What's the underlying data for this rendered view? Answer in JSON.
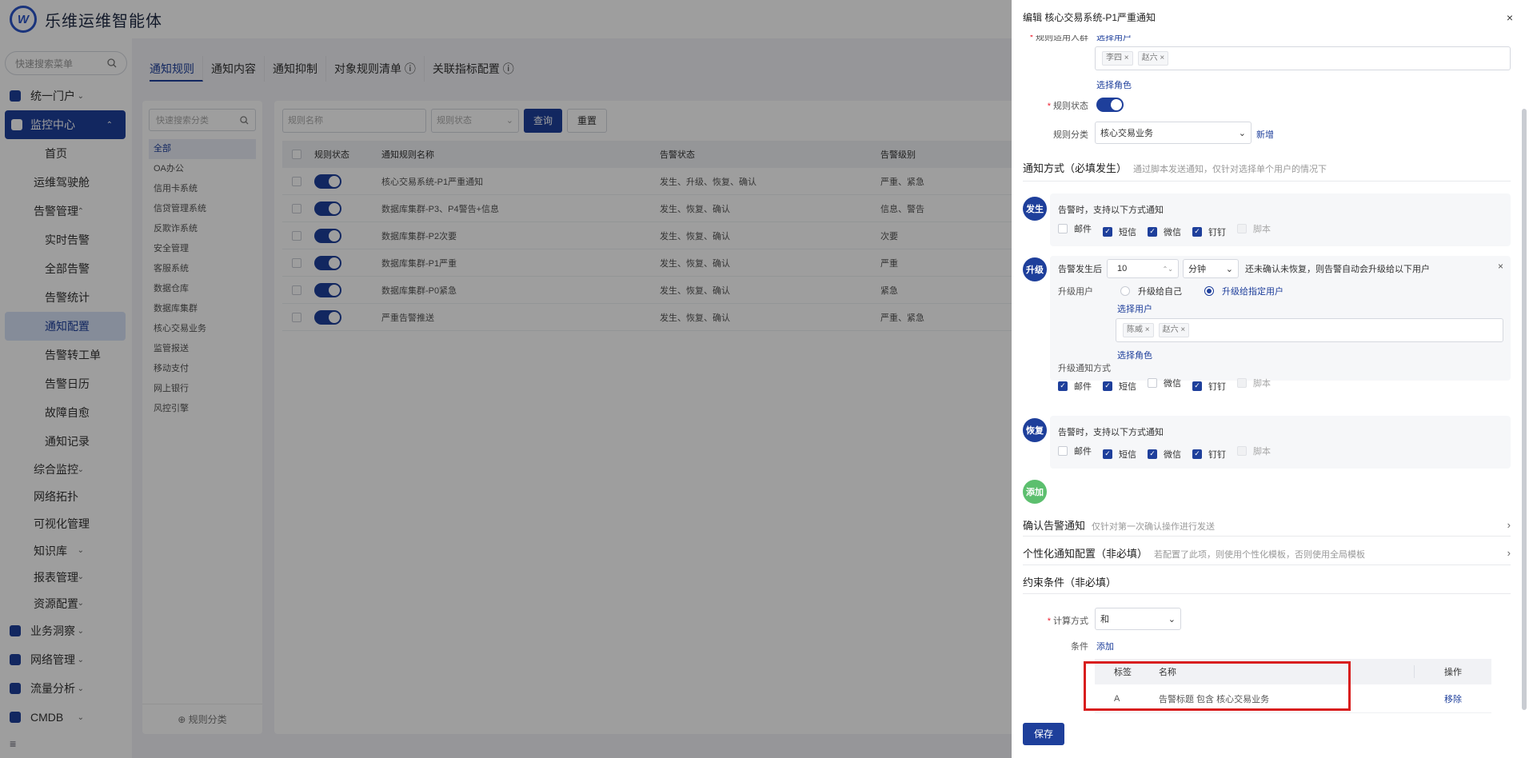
{
  "app": {
    "title": "乐维运维智能体"
  },
  "sidebar": {
    "search_placeholder": "快速搜索菜单",
    "items": [
      {
        "label": "统一门户",
        "arrow": "⌄"
      },
      {
        "label": "监控中心",
        "arrow": "⌃"
      },
      {
        "label": "首页"
      },
      {
        "label": "运维驾驶舱"
      },
      {
        "label": "告警管理",
        "arrow": "⌃"
      },
      {
        "label": "实时告警"
      },
      {
        "label": "全部告警"
      },
      {
        "label": "告警统计"
      },
      {
        "label": "通知配置"
      },
      {
        "label": "告警转工单"
      },
      {
        "label": "告警日历"
      },
      {
        "label": "故障自愈"
      },
      {
        "label": "通知记录"
      },
      {
        "label": "综合监控",
        "arrow": "⌄"
      },
      {
        "label": "网络拓扑"
      },
      {
        "label": "可视化管理",
        "arrow": "⌄"
      },
      {
        "label": "知识库",
        "arrow": "⌄"
      },
      {
        "label": "报表管理",
        "arrow": "⌄"
      },
      {
        "label": "资源配置",
        "arrow": "⌄"
      },
      {
        "label": "业务洞察",
        "arrow": "⌄"
      },
      {
        "label": "网络管理",
        "arrow": "⌄"
      },
      {
        "label": "流量分析",
        "arrow": "⌄"
      },
      {
        "label": "CMDB",
        "arrow": "⌄"
      }
    ],
    "bottom_icon": "≡"
  },
  "tabs": [
    "通知规则",
    "通知内容",
    "通知抑制",
    "对象规则清单 ⓘ",
    "关联指标配置 ⓘ"
  ],
  "categories": {
    "search_placeholder": "快速搜索分类",
    "items": [
      "全部",
      "OA办公",
      "信用卡系统",
      "信贷管理系统",
      "反欺诈系统",
      "安全管理",
      "客服系统",
      "数据仓库",
      "数据库集群",
      "核心交易业务",
      "监管报送",
      "移动支付",
      "网上银行",
      "风控引擎"
    ],
    "footer": "⊕ 规则分类"
  },
  "filters": {
    "name_placeholder": "规则名称",
    "status_placeholder": "规则状态",
    "query": "查询",
    "reset": "重置"
  },
  "rules_table": {
    "headers": [
      "规则状态",
      "通知规则名称",
      "告警状态",
      "告警级别"
    ],
    "rows": [
      {
        "name": "核心交易系统-P1严重通知",
        "states": "发生、升级、恢复、确认",
        "levels": "严重、紧急"
      },
      {
        "name": "数据库集群-P3、P4警告+信息",
        "states": "发生、恢复、确认",
        "levels": "信息、警告"
      },
      {
        "name": "数据库集群-P2次要",
        "states": "发生、恢复、确认",
        "levels": "次要"
      },
      {
        "name": "数据库集群-P1严重",
        "states": "发生、恢复、确认",
        "levels": "严重"
      },
      {
        "name": "数据库集群-P0紧急",
        "states": "发生、恢复、确认",
        "levels": "紧急"
      },
      {
        "name": "严重告警推送",
        "states": "发生、恢复、确认",
        "levels": "严重、紧急"
      }
    ]
  },
  "drawer": {
    "title": "编辑 核心交易系统-P1严重通知",
    "close": "×",
    "audience_label": "规则适用人群",
    "select_user": "选择用户",
    "audience_tags": [
      "李四 ×",
      "赵六 ×"
    ],
    "select_role": "选择角色",
    "status_label": "规则状态",
    "category_label": "规则分类",
    "category_value": "核心交易业务",
    "add_category": "新增",
    "notify_title": "通知方式（必填发生）",
    "notify_sub": "通过脚本发送通知，仅针对选择单个用户的情况下",
    "steps": {
      "occur": {
        "badge": "发生",
        "hint": "告警时，支持以下方式通知",
        "channels": [
          {
            "label": "邮件",
            "checked": false
          },
          {
            "label": "短信",
            "checked": true
          },
          {
            "label": "微信",
            "checked": true
          },
          {
            "label": "钉钉",
            "checked": true
          },
          {
            "label": "脚本",
            "checked": false,
            "disabled": true
          }
        ]
      },
      "escalate": {
        "badge": "升级",
        "after_label": "告警发生后",
        "after_value": "10",
        "unit": "分钟",
        "after_tail": "还未确认未恢复，则告警自动会升级给以下用户",
        "close": "×",
        "user_label": "升级用户",
        "radio_self": "升级给自己",
        "radio_target": "升级给指定用户",
        "select_user": "选择用户",
        "tags": [
          "陈威 ×",
          "赵六 ×"
        ],
        "select_role": "选择角色",
        "channel_label": "升级通知方式",
        "channels": [
          {
            "label": "邮件",
            "checked": true
          },
          {
            "label": "短信",
            "checked": true
          },
          {
            "label": "微信",
            "checked": false
          },
          {
            "label": "钉钉",
            "checked": true
          },
          {
            "label": "脚本",
            "checked": false,
            "disabled": true
          }
        ]
      },
      "recover": {
        "badge": "恢复",
        "hint": "告警时，支持以下方式通知",
        "channels": [
          {
            "label": "邮件",
            "checked": false
          },
          {
            "label": "短信",
            "checked": true
          },
          {
            "label": "微信",
            "checked": true
          },
          {
            "label": "钉钉",
            "checked": true
          },
          {
            "label": "脚本",
            "checked": false,
            "disabled": true
          }
        ]
      },
      "add": {
        "badge": "添加"
      }
    },
    "confirm_title": "确认告警通知",
    "confirm_sub": "仅针对第一次确认操作进行发送",
    "personal_title": "个性化通知配置（非必填）",
    "personal_sub": "若配置了此项，则使用个性化模板，否则使用全局模板",
    "constraint_title": "约束条件（非必填）",
    "calc_label": "计算方式",
    "calc_value": "和",
    "cond_label": "条件",
    "cond_add": "添加",
    "cond_table": {
      "headers": [
        "标签",
        "名称",
        "操作"
      ],
      "rows": [
        {
          "tag": "A",
          "name": "告警标题 包含 核心交易业务",
          "action": "移除"
        }
      ]
    },
    "save": "保存"
  },
  "colors": {
    "primary": "#1e3f9b",
    "add_badge": "#5cbf6e",
    "highlight": "#d81e1e"
  }
}
